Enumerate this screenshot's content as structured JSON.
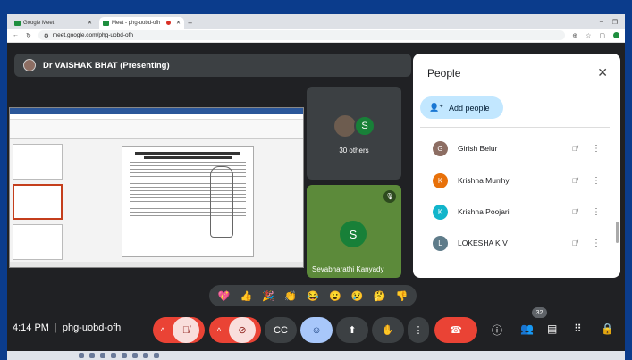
{
  "browser": {
    "tabs": [
      {
        "label": "Google Meet",
        "active": false
      },
      {
        "label": "Meet - phg-uobd-ofh",
        "active": true
      }
    ],
    "url": "meet.google.com/phg-uobd-ofh"
  },
  "presenter": {
    "label": "Dr VAISHAK BHAT (Presenting)"
  },
  "tiles": {
    "others": {
      "initial": "S",
      "label": "30 others"
    },
    "seva": {
      "initial": "S",
      "name": "Sevabharathi Kanyady"
    }
  },
  "people_panel": {
    "title": "People",
    "add_people": "Add people",
    "participants": [
      {
        "name": "Girish Belur",
        "initial": "G",
        "color": "#8d6e63"
      },
      {
        "name": "Krishna Murrhy",
        "initial": "K",
        "color": "#e8710a"
      },
      {
        "name": "Krishna Poojari",
        "initial": "K",
        "color": "#12b5cb"
      },
      {
        "name": "LOKESHA K V",
        "initial": "L",
        "color": "#5f7c8a"
      }
    ]
  },
  "reactions": [
    "💖",
    "👍",
    "🎉",
    "👏",
    "😂",
    "😮",
    "😢",
    "🤔",
    "👎"
  ],
  "controls": {
    "time": "4:14 PM",
    "meeting_code": "phg-uobd-ofh",
    "participant_count": "32"
  },
  "colors": {
    "accent": "#a8c7fa",
    "end_call": "#ea4335",
    "muted": "#f9dedc"
  }
}
